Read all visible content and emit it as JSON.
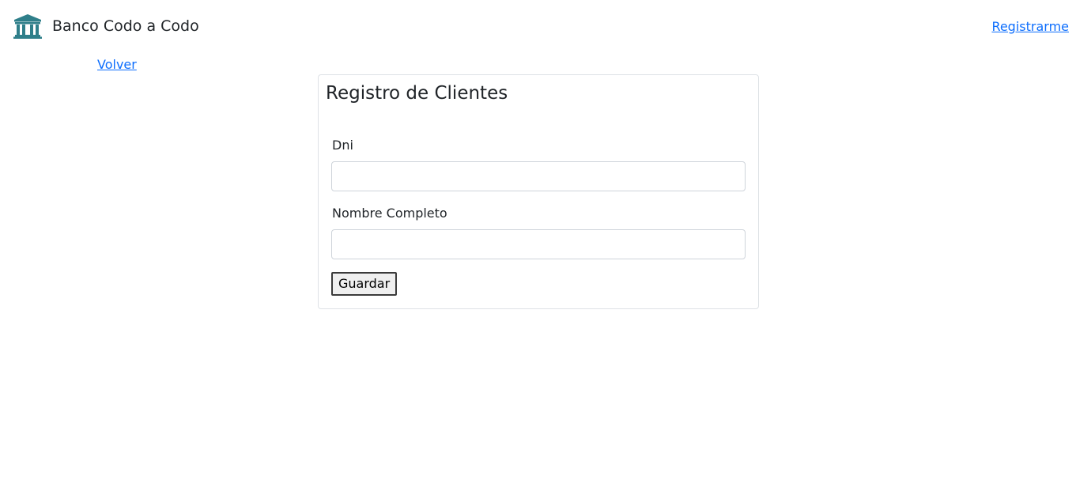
{
  "header": {
    "brand_name": "Banco Codo a Codo",
    "brand_icon": "bank-building-icon",
    "register_link": "Registrarme"
  },
  "nav": {
    "back_link": "Volver"
  },
  "form": {
    "title": "Registro de Clientes",
    "fields": [
      {
        "label": "Dni",
        "value": "",
        "placeholder": ""
      },
      {
        "label": "Nombre Completo",
        "value": "",
        "placeholder": ""
      }
    ],
    "submit_label": "Guardar"
  },
  "colors": {
    "link": "#0d6efd",
    "logo": "#2f7f8a",
    "text": "#212529",
    "border": "#dee2e6"
  }
}
